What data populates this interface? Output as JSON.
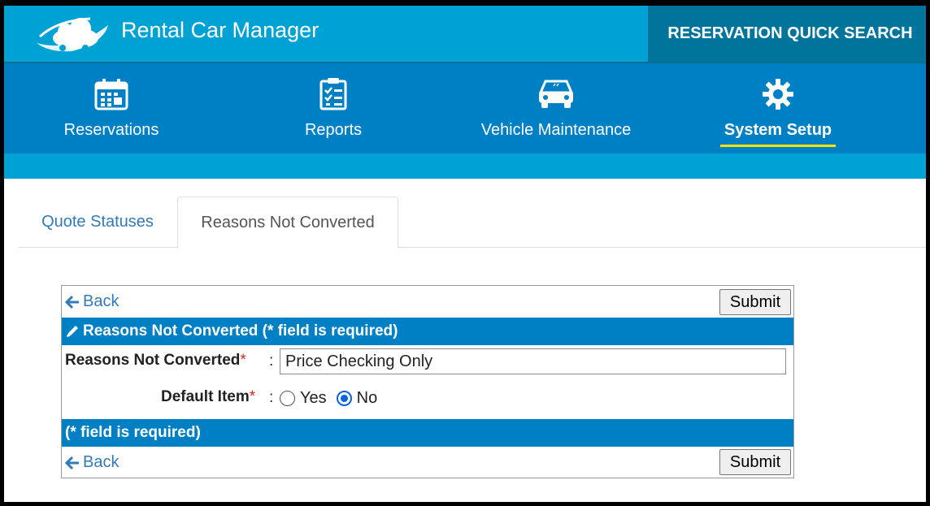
{
  "app": {
    "title": "Rental Car Manager",
    "quick_search": "RESERVATION QUICK SEARCH"
  },
  "nav": {
    "items": [
      {
        "label": "Reservations",
        "icon": "calendar-icon"
      },
      {
        "label": "Reports",
        "icon": "checklist-icon"
      },
      {
        "label": "Vehicle Maintenance",
        "icon": "car-icon"
      },
      {
        "label": "System Setup",
        "icon": "gear-icon",
        "active": true
      }
    ]
  },
  "tabs": [
    {
      "label": "Quote Statuses",
      "active": false
    },
    {
      "label": "Reasons Not Converted",
      "active": true
    }
  ],
  "form": {
    "back_label": "Back",
    "submit_label": "Submit",
    "header": "Reasons Not Converted (* field is required)",
    "footer_note": "(* field is required)",
    "fields": {
      "reason": {
        "label": "Reasons Not Converted",
        "required_mark": "*",
        "value": "Price Checking Only"
      },
      "default_item": {
        "label": "Default Item",
        "required_mark": "*",
        "options": [
          "Yes",
          "No"
        ],
        "selected": "No"
      }
    },
    "colon": ":"
  },
  "colors": {
    "header_blue": "#00a2d3",
    "nav_blue": "#0080c4",
    "quick_search_bg": "#00749b",
    "active_underline": "#f5e400"
  }
}
